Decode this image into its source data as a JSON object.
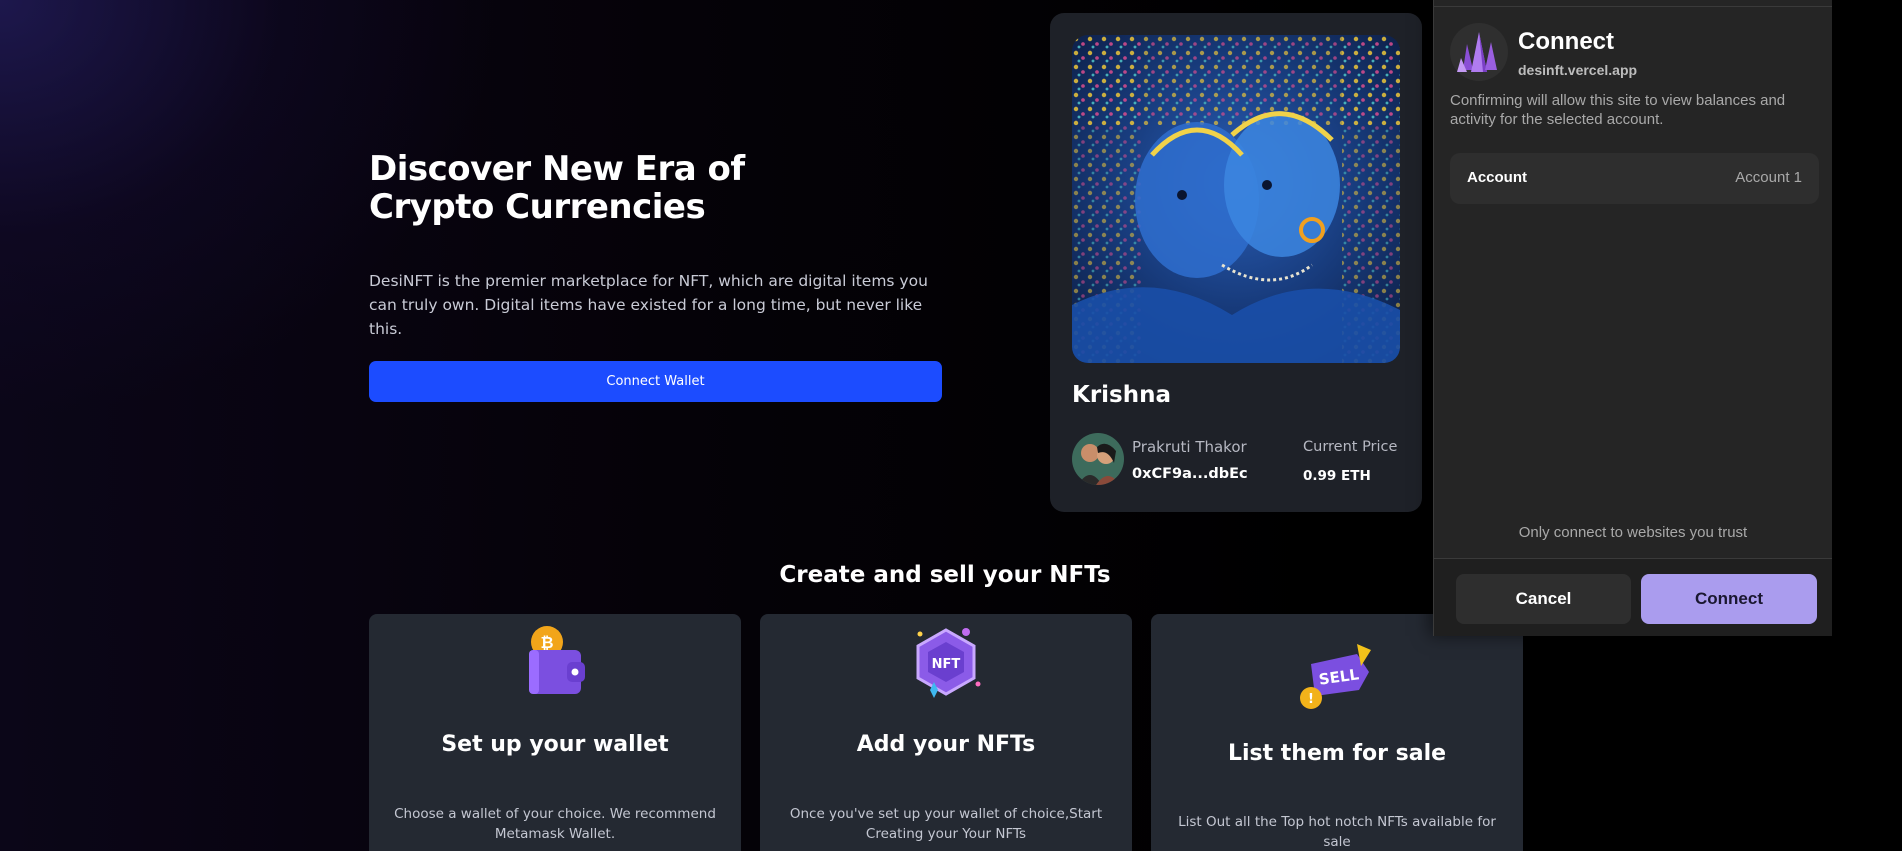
{
  "hero": {
    "title": "Discover New Era of Crypto Currencies",
    "description": "DesiNFT is the premier marketplace for NFT, which are digital items you can truly own. Digital items have existed for a long time, but never like this.",
    "connect_wallet_label": "Connect Wallet"
  },
  "nft_card": {
    "name": "Krishna",
    "owner_name": "Prakruti Thakor",
    "owner_address": "0xCF9a...dbEc",
    "price_label": "Current Price",
    "price_value": "0.99 ETH"
  },
  "section": {
    "title": "Create and sell your NFTs",
    "features": [
      {
        "icon": "wallet-icon",
        "title": "Set up your wallet",
        "description": "Choose a wallet of your choice. We recommend Metamask Wallet."
      },
      {
        "icon": "nft-badge-icon",
        "title": "Add your NFTs",
        "description": "Once you've set up your wallet of choice,Start Creating your Your NFTs"
      },
      {
        "icon": "sell-tag-icon",
        "title": "List them for sale",
        "description": "List Out all the Top hot notch NFTs available for sale"
      }
    ]
  },
  "popup": {
    "title": "Connect",
    "site": "desinft.vercel.app",
    "description": "Confirming will allow this site to view balances and activity for the selected account.",
    "account_label": "Account",
    "account_value": "Account 1",
    "trust_note": "Only connect to websites you trust",
    "cancel_label": "Cancel",
    "connect_label": "Connect"
  },
  "colors": {
    "accent_blue": "#1c4cff",
    "popup_connect": "#aa9cee",
    "card_bg": "#242932"
  }
}
